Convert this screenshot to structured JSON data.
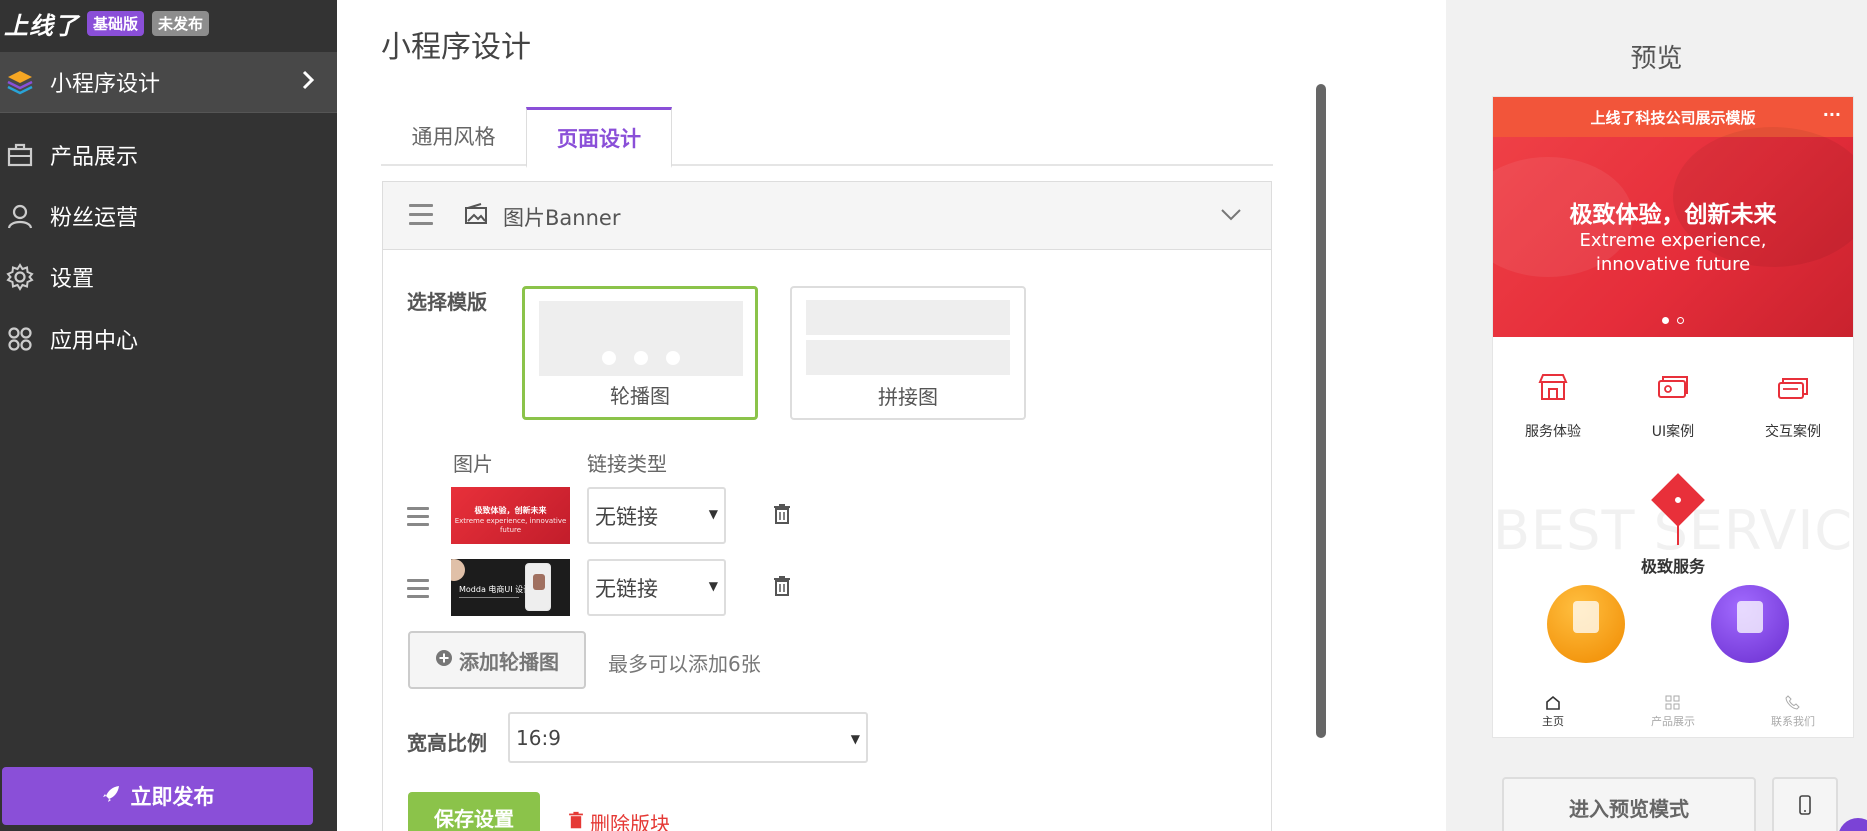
{
  "brand": {
    "logo": "上线了",
    "edition_badge": "基础版",
    "status_badge": "未发布"
  },
  "sidebar": {
    "items": [
      {
        "label": "小程序设计",
        "icon": "layers-icon",
        "active": true
      },
      {
        "label": "产品展示",
        "icon": "briefcase-icon"
      },
      {
        "label": "粉丝运营",
        "icon": "user-icon"
      },
      {
        "label": "设置",
        "icon": "gear-icon"
      },
      {
        "label": "应用中心",
        "icon": "apps-grid-icon"
      }
    ],
    "publish_label": "立即发布"
  },
  "main": {
    "title": "小程序设计",
    "tabs": [
      {
        "label": "通用风格",
        "active": false
      },
      {
        "label": "页面设计",
        "active": true
      }
    ],
    "block": {
      "title": "图片Banner",
      "select_template_label": "选择模版",
      "templates": [
        {
          "label": "轮播图",
          "selected": true
        },
        {
          "label": "拼接图",
          "selected": false
        }
      ],
      "columns": {
        "image": "图片",
        "link_type": "链接类型"
      },
      "rows": [
        {
          "thumb_title": "极致体验，创新未来",
          "thumb_sub": "Extreme experience, innovative future",
          "link": "无链接"
        },
        {
          "thumb_title": "Modda 电商UI 设计",
          "link": "无链接"
        }
      ],
      "add_button": "添加轮播图",
      "add_hint": "最多可以添加6张",
      "ratio_label": "宽高比例",
      "ratio_value": "16:9",
      "save_button": "保存设置",
      "delete_link": "删除版块"
    }
  },
  "preview": {
    "title": "预览",
    "app_title": "上线了科技公司展示模版",
    "more": "···",
    "banner_title": "极致体验，创新未来",
    "banner_sub_1": "Extreme experience,",
    "banner_sub_2": "innovative future",
    "grid": [
      {
        "label": "服务体验",
        "icon": "store-icon"
      },
      {
        "label": "UI案例",
        "icon": "cards-icon"
      },
      {
        "label": "交互案例",
        "icon": "stack-icon"
      }
    ],
    "watermark": "BEST SERVICE",
    "service_label": "极致服务",
    "tabbar": [
      {
        "label": "主页",
        "icon": "home-icon",
        "active": true
      },
      {
        "label": "产品展示",
        "icon": "grid-icon",
        "active": false
      },
      {
        "label": "联系我们",
        "icon": "phone-icon",
        "active": false
      }
    ],
    "enter_button": "进入预览模式"
  },
  "colors": {
    "accent_purple": "#8a4fd8",
    "accent_green": "#8bc34a",
    "danger_red": "#e53935",
    "banner_red": "#e8303a",
    "header_orange": "#f2553a"
  }
}
